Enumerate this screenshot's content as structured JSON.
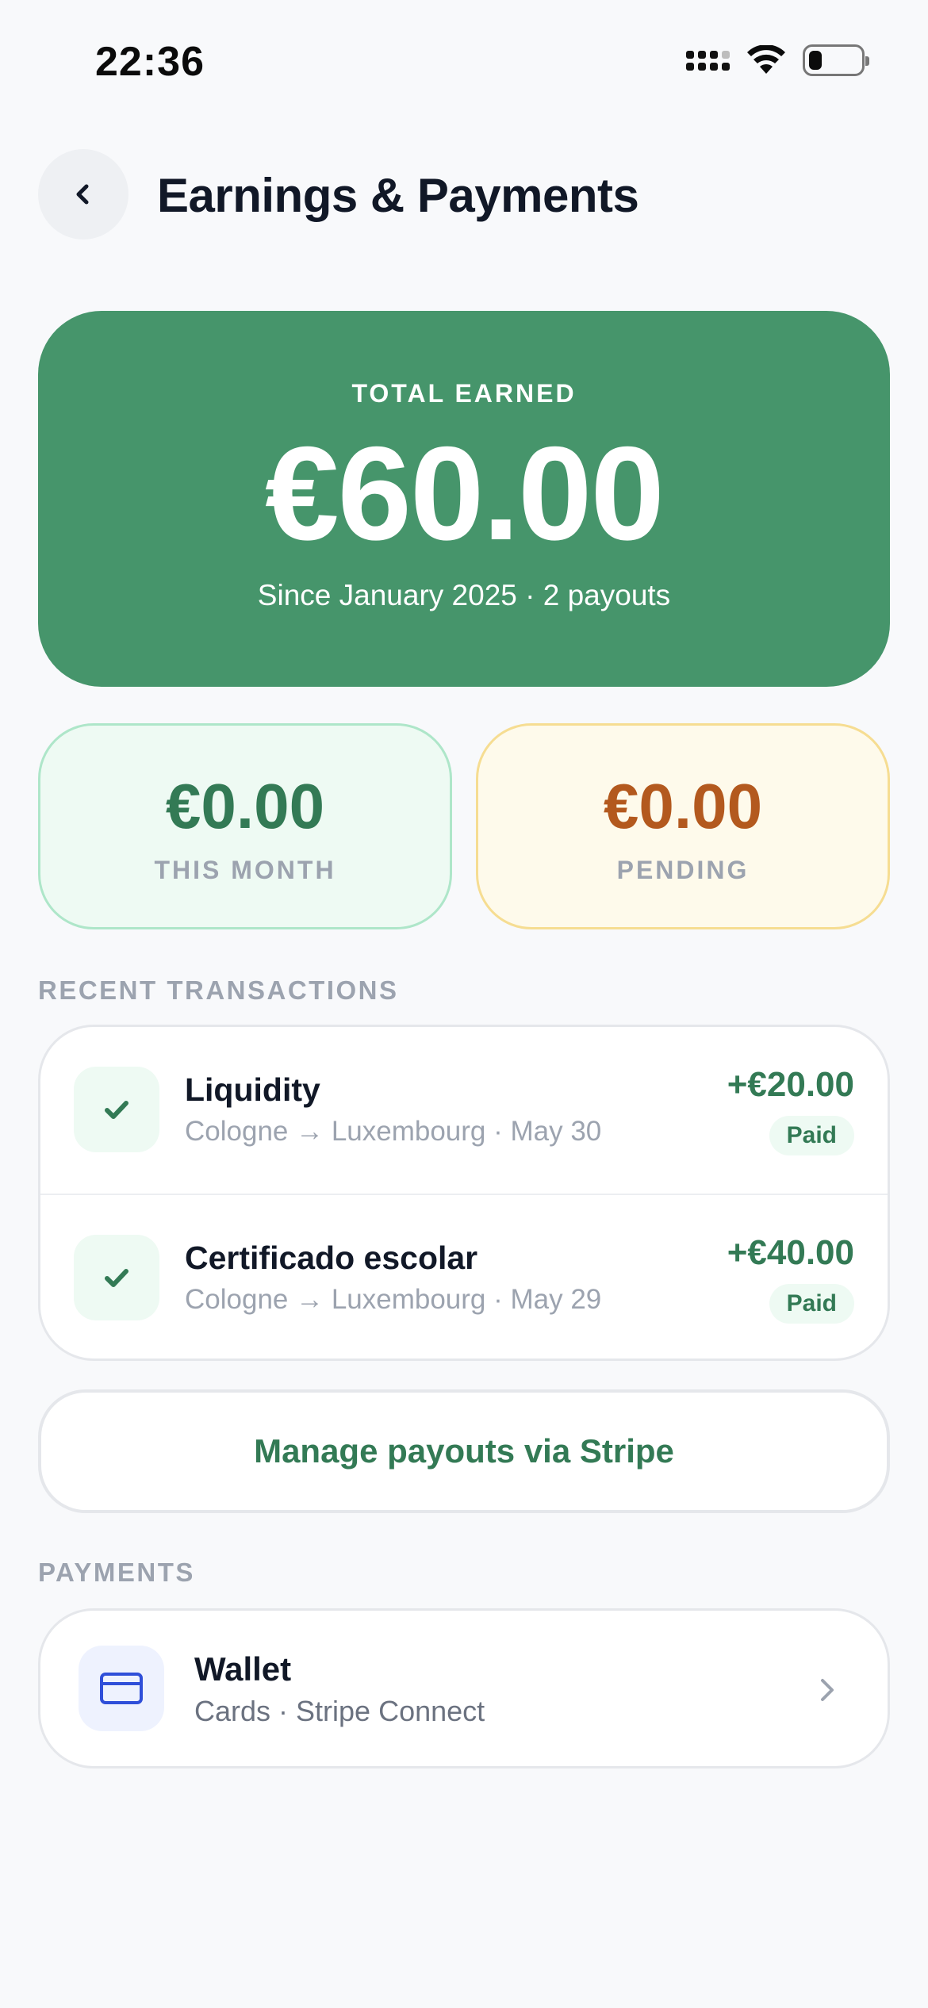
{
  "status_bar": {
    "time": "22:36",
    "battery_level": 0.25,
    "icons": [
      "cellular-signal-icon",
      "wifi-icon",
      "battery-icon"
    ]
  },
  "header": {
    "title": "Earnings & Payments",
    "back_icon": "chevron-left-icon"
  },
  "summary": {
    "total_label": "TOTAL EARNED",
    "total_amount": "€60.00",
    "total_sub": "Since January 2025 · 2 payouts",
    "this_month_amount": "€0.00",
    "this_month_label": "THIS MONTH",
    "pending_amount": "€0.00",
    "pending_label": "PENDING"
  },
  "transactions": {
    "section_label": "RECENT TRANSACTIONS",
    "items": [
      {
        "title": "Liquidity",
        "subtitle": "Cologne → Luxembourg · May 30",
        "amount": "+€20.00",
        "status": "Paid",
        "icon": "checkmark-icon"
      },
      {
        "title": "Certificado escolar",
        "subtitle": "Cologne → Luxembourg · May 29",
        "amount": "+€40.00",
        "status": "Paid",
        "icon": "checkmark-icon"
      }
    ]
  },
  "actions": {
    "manage_payouts_label": "Manage payouts via Stripe"
  },
  "payments": {
    "section_label": "PAYMENTS",
    "wallet_title": "Wallet",
    "wallet_subtitle": "Cards · Stripe Connect",
    "wallet_icon": "credit-card-icon",
    "chevron_icon": "chevron-right-icon"
  },
  "colors": {
    "brand_green": "#46956b",
    "text_green": "#337a55",
    "pending_orange": "#b3591e",
    "wallet_blue": "#2f4fd9"
  }
}
